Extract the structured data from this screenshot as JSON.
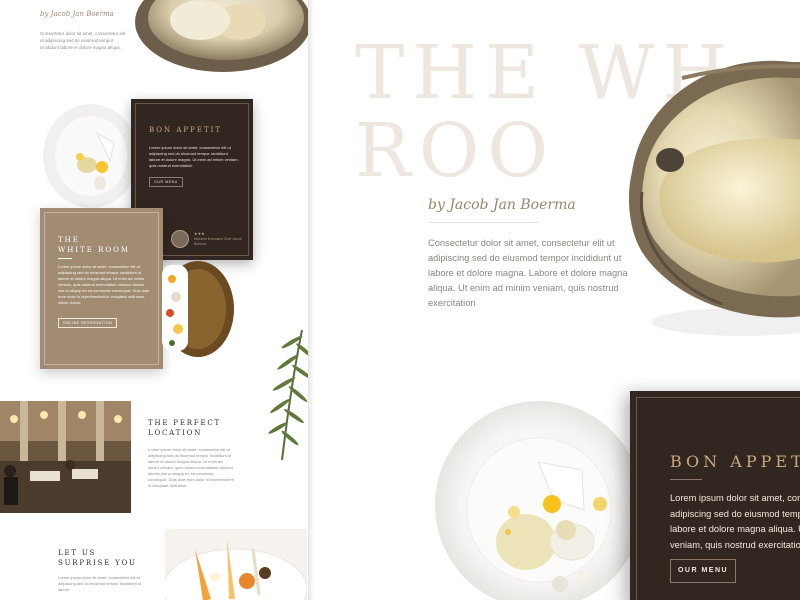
{
  "colors": {
    "dark_card": "#322720",
    "tan_card": "#a28b73",
    "gold_accent": "#c9a880",
    "watermark": "#eee7df",
    "byline": "#9a8468",
    "body_text": "#8b8680"
  },
  "mini": {
    "byline": "by Jacob Jan Boerma",
    "intro": "Consectetur dolor sit amet, consectetur elit ut adipiscing sed do eiusmod tempor incididunt labore et dolore magna aliqua.",
    "bon_appetit": {
      "title": "BON APPETIT",
      "text": "Lorem ipsum dolor sit amet, consectetur elit ut adipiscing sed do eiusmod tempor incididunt labore et dolore magna. Ut enim ad minim veniam, quis nostrud exercitation",
      "button": "OUR MENU",
      "stars": "★★★",
      "chef": "Michelin Executive Chef Jacob Boerma"
    },
    "white_room": {
      "title_line1": "THE",
      "title_line2": "WHITE ROOM",
      "text": "Lorem ipsum dolor sit amet, consectetur elit ut adipiscing sed do eiusmod tempor incididunt ut labore et dolore magna aliqua. Ut enim ad minim veniam, quis nostrud exercitation ullamco laboris nisi ut aliquip ex ea commodo consequat. Duis aute irure dolor in reprehenderit in voluptate velit esse cillum dolore.",
      "button": "ONLINE RESERVATION"
    },
    "location": {
      "title_line1": "THE PERFECT",
      "title_line2": "LOCATION",
      "text": "Lorem ipsum dolor sit amet, consectetur elit ut adipiscing sed do eiusmod tempor incididunt ut labore et dolore magna aliqua. Ut enim ad minim veniam, quis nostrud exercitation ullamco laboris nisi ut aliquip ex ea commodo consequat. Duis aute irure dolor in reprehenderit in voluptate velit esse."
    },
    "surprise": {
      "title_line1": "LET US",
      "title_line2": "SURPRISE YOU",
      "text": "Lorem ipsum dolor sit amet, consectetur elit ut adipiscing sed do eiusmod tempor incididunt ut labore."
    }
  },
  "hero": {
    "watermark": "THE WH\nROO",
    "byline": "by Jacob Jan Boerma",
    "text": "Consectetur dolor sit amet, consectetur elit ut adipiscing sed do eiusmod tempor incididunt ut labore et dolore magna. Labore et dolore magna aliqua. Ut enim ad minim veniam, quis nostrud exercitation"
  },
  "bon_appetit": {
    "title": "BON APPETIT",
    "text_lines": [
      "Lorem ipsum dolor sit amet, consectetur elit ut",
      "adipiscing sed do eiusmod tempor incididunt ut",
      "labore et dolore magna aliqua. Ut enim ad minim",
      "veniam, quis nostrud exercitation"
    ],
    "button": "OUR MENU"
  }
}
